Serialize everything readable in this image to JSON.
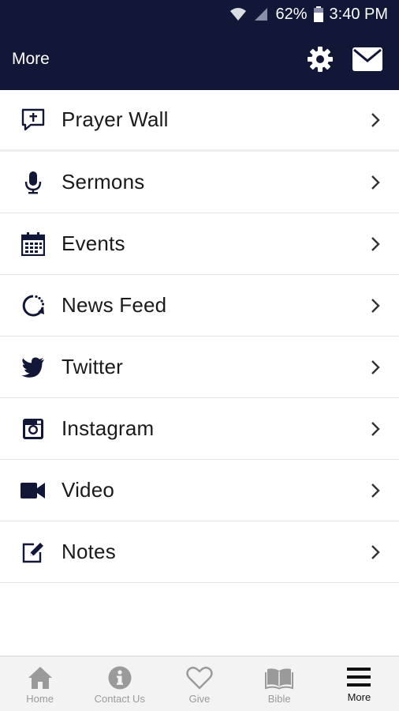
{
  "status_bar": {
    "battery": "62%",
    "time": "3:40 PM"
  },
  "header": {
    "title": "More",
    "settings_icon": "gear-icon",
    "mail_icon": "mail-icon"
  },
  "menu": {
    "items": [
      {
        "label": "Prayer Wall",
        "icon": "prayer-icon"
      },
      {
        "label": "Sermons",
        "icon": "microphone-icon"
      },
      {
        "label": "Events",
        "icon": "calendar-icon"
      },
      {
        "label": "News Feed",
        "icon": "refresh-icon"
      },
      {
        "label": "Twitter",
        "icon": "twitter-icon"
      },
      {
        "label": "Instagram",
        "icon": "instagram-icon"
      },
      {
        "label": "Video",
        "icon": "video-icon"
      },
      {
        "label": "Notes",
        "icon": "notes-icon"
      }
    ]
  },
  "tabs": [
    {
      "label": "Home",
      "icon": "home-icon"
    },
    {
      "label": "Contact Us",
      "icon": "info-icon"
    },
    {
      "label": "Give",
      "icon": "heart-icon"
    },
    {
      "label": "Bible",
      "icon": "book-icon"
    },
    {
      "label": "More",
      "icon": "menu-icon",
      "active": true
    }
  ],
  "colors": {
    "header_bg": "#121737",
    "icon": "#121737",
    "tab_inactive": "#9a9a9a",
    "tab_active": "#111111"
  }
}
